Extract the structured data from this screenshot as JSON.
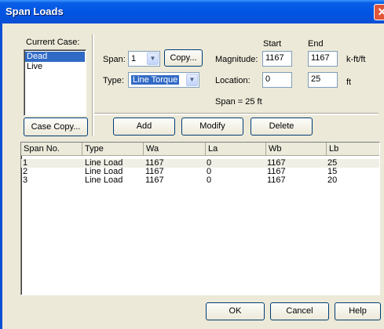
{
  "window": {
    "title": "Span Loads",
    "close_glyph": "✕"
  },
  "cases": {
    "label": "Current Case:",
    "items": [
      "Dead",
      "Live"
    ],
    "selected": "Dead",
    "copy_button": "Case Copy..."
  },
  "span": {
    "label": "Span:",
    "value": "1",
    "copy_button": "Copy...",
    "type_label": "Type:",
    "type_value": "Line Torque",
    "span_text": "Span = 25 ft"
  },
  "magnitude": {
    "label": "Magnitude:",
    "start_header": "Start",
    "end_header": "End",
    "start": "1167",
    "end": "1167",
    "unit": "k-ft/ft"
  },
  "location": {
    "label": "Location:",
    "start": "0",
    "end": "25",
    "unit": "ft"
  },
  "actions": {
    "add": "Add",
    "modify": "Modify",
    "delete": "Delete"
  },
  "table": {
    "columns": [
      "Span No.",
      "Type",
      "Wa",
      "La",
      "Wb",
      "Lb"
    ],
    "rows": [
      [
        "1",
        "Line Load",
        "1167",
        "0",
        "1167",
        "25"
      ],
      [
        "2",
        "Line Load",
        "1167",
        "0",
        "1167",
        "15"
      ],
      [
        "3",
        "Line Load",
        "1167",
        "0",
        "1167",
        "20"
      ]
    ]
  },
  "footer": {
    "ok": "OK",
    "cancel": "Cancel",
    "help": "Help"
  },
  "icons": {
    "combo_arrow": "▼"
  }
}
